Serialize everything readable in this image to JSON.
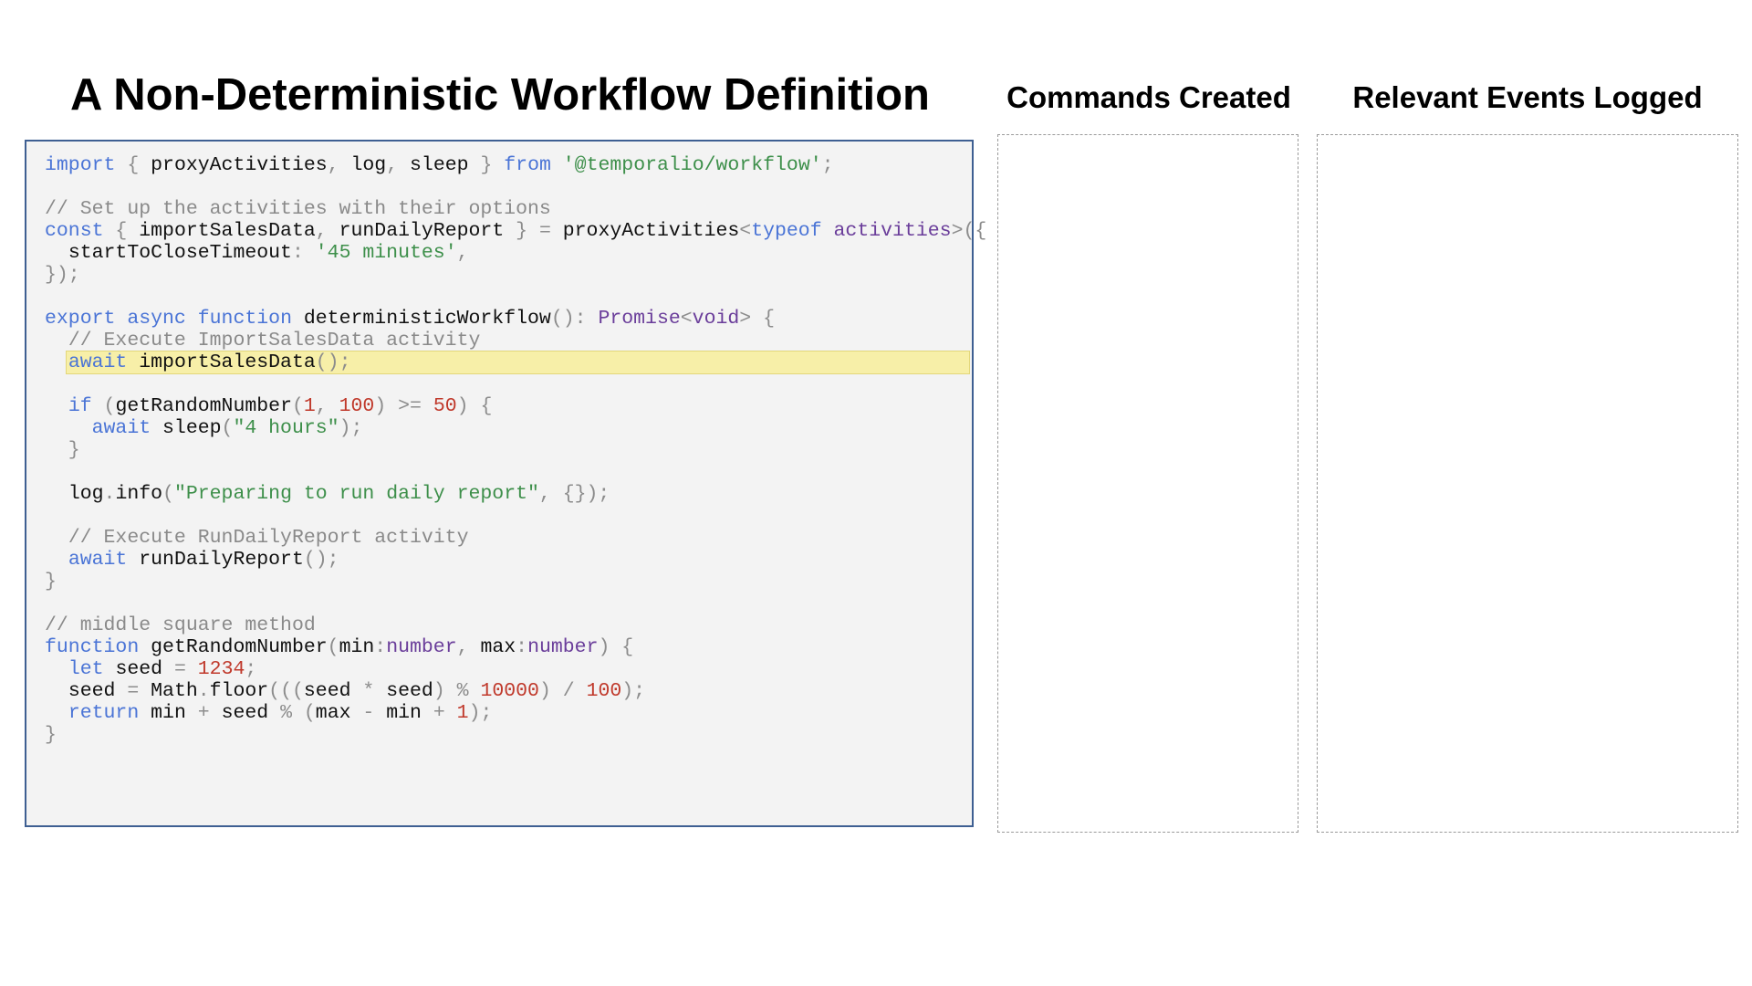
{
  "slide": {
    "title": "A Non-Deterministic Workflow Definition",
    "commands_title": "Commands Created",
    "events_title": "Relevant Events Logged"
  },
  "code": {
    "highlighted_line": 9,
    "lines": [
      [
        [
          "kw",
          "import"
        ],
        [
          "pu",
          " { "
        ],
        [
          "id",
          "proxyActivities"
        ],
        [
          "pu",
          ", "
        ],
        [
          "id",
          "log"
        ],
        [
          "pu",
          ", "
        ],
        [
          "id",
          "sleep"
        ],
        [
          "pu",
          " } "
        ],
        [
          "kw",
          "from"
        ],
        [
          "pu",
          " "
        ],
        [
          "st",
          "'@temporalio/workflow'"
        ],
        [
          "pu",
          ";"
        ]
      ],
      [],
      [
        [
          "cm",
          "// Set up the activities with their options"
        ]
      ],
      [
        [
          "kw",
          "const"
        ],
        [
          "pu",
          " { "
        ],
        [
          "id",
          "importSalesData"
        ],
        [
          "pu",
          ", "
        ],
        [
          "id",
          "runDailyReport"
        ],
        [
          "pu",
          " } = "
        ],
        [
          "id",
          "proxyActivities"
        ],
        [
          "pu",
          "<"
        ],
        [
          "kw",
          "typeof"
        ],
        [
          "pu",
          " "
        ],
        [
          "ty",
          "activities"
        ],
        [
          "pu",
          ">({"
        ]
      ],
      [
        [
          "pu",
          "  "
        ],
        [
          "id",
          "startToCloseTimeout"
        ],
        [
          "pu",
          ": "
        ],
        [
          "st",
          "'45 minutes'"
        ],
        [
          "pu",
          ","
        ]
      ],
      [
        [
          "pu",
          "});"
        ]
      ],
      [],
      [
        [
          "kw",
          "export"
        ],
        [
          "pu",
          " "
        ],
        [
          "kw",
          "async"
        ],
        [
          "pu",
          " "
        ],
        [
          "kw",
          "function"
        ],
        [
          "pu",
          " "
        ],
        [
          "id",
          "deterministicWorkflow"
        ],
        [
          "pu",
          "(): "
        ],
        [
          "ty",
          "Promise"
        ],
        [
          "pu",
          "<"
        ],
        [
          "ty",
          "void"
        ],
        [
          "pu",
          "> {"
        ]
      ],
      [
        [
          "pu",
          "  "
        ],
        [
          "cm",
          "// Execute ImportSalesData activity"
        ]
      ],
      [
        [
          "pu",
          "  "
        ],
        [
          "kw",
          "await"
        ],
        [
          "pu",
          " "
        ],
        [
          "id",
          "importSalesData"
        ],
        [
          "pu",
          "();"
        ]
      ],
      [],
      [
        [
          "pu",
          "  "
        ],
        [
          "kw",
          "if"
        ],
        [
          "pu",
          " ("
        ],
        [
          "id",
          "getRandomNumber"
        ],
        [
          "pu",
          "("
        ],
        [
          "nu",
          "1"
        ],
        [
          "pu",
          ", "
        ],
        [
          "nu",
          "100"
        ],
        [
          "pu",
          ") >= "
        ],
        [
          "nu",
          "50"
        ],
        [
          "pu",
          ") {"
        ]
      ],
      [
        [
          "pu",
          "    "
        ],
        [
          "kw",
          "await"
        ],
        [
          "pu",
          " "
        ],
        [
          "id",
          "sleep"
        ],
        [
          "pu",
          "("
        ],
        [
          "st",
          "\"4 hours\""
        ],
        [
          "pu",
          ");"
        ]
      ],
      [
        [
          "pu",
          "  }"
        ]
      ],
      [],
      [
        [
          "pu",
          "  "
        ],
        [
          "id",
          "log"
        ],
        [
          "pu",
          "."
        ],
        [
          "id",
          "info"
        ],
        [
          "pu",
          "("
        ],
        [
          "st",
          "\"Preparing to run daily report\""
        ],
        [
          "pu",
          ", {});"
        ]
      ],
      [],
      [
        [
          "pu",
          "  "
        ],
        [
          "cm",
          "// Execute RunDailyReport activity"
        ]
      ],
      [
        [
          "pu",
          "  "
        ],
        [
          "kw",
          "await"
        ],
        [
          "pu",
          " "
        ],
        [
          "id",
          "runDailyReport"
        ],
        [
          "pu",
          "();"
        ]
      ],
      [
        [
          "pu",
          "}"
        ]
      ],
      [],
      [
        [
          "cm",
          "// middle square method"
        ]
      ],
      [
        [
          "kw",
          "function"
        ],
        [
          "pu",
          " "
        ],
        [
          "id",
          "getRandomNumber"
        ],
        [
          "pu",
          "("
        ],
        [
          "id",
          "min"
        ],
        [
          "pu",
          ":"
        ],
        [
          "ty",
          "number"
        ],
        [
          "pu",
          ", "
        ],
        [
          "id",
          "max"
        ],
        [
          "pu",
          ":"
        ],
        [
          "ty",
          "number"
        ],
        [
          "pu",
          ") {"
        ]
      ],
      [
        [
          "pu",
          "  "
        ],
        [
          "kw",
          "let"
        ],
        [
          "pu",
          " "
        ],
        [
          "id",
          "seed"
        ],
        [
          "pu",
          " = "
        ],
        [
          "nu",
          "1234"
        ],
        [
          "pu",
          ";"
        ]
      ],
      [
        [
          "pu",
          "  "
        ],
        [
          "id",
          "seed"
        ],
        [
          "pu",
          " = "
        ],
        [
          "id",
          "Math"
        ],
        [
          "pu",
          "."
        ],
        [
          "id",
          "floor"
        ],
        [
          "pu",
          "((("
        ],
        [
          "id",
          "seed"
        ],
        [
          "pu",
          " * "
        ],
        [
          "id",
          "seed"
        ],
        [
          "pu",
          ") % "
        ],
        [
          "nu",
          "10000"
        ],
        [
          "pu",
          ") / "
        ],
        [
          "nu",
          "100"
        ],
        [
          "pu",
          ");"
        ]
      ],
      [
        [
          "pu",
          "  "
        ],
        [
          "kw",
          "return"
        ],
        [
          "pu",
          " "
        ],
        [
          "id",
          "min"
        ],
        [
          "pu",
          " + "
        ],
        [
          "id",
          "seed"
        ],
        [
          "pu",
          " % ("
        ],
        [
          "id",
          "max"
        ],
        [
          "pu",
          " - "
        ],
        [
          "id",
          "min"
        ],
        [
          "pu",
          " + "
        ],
        [
          "nu",
          "1"
        ],
        [
          "pu",
          ");"
        ]
      ],
      [
        [
          "pu",
          "}"
        ]
      ]
    ]
  }
}
